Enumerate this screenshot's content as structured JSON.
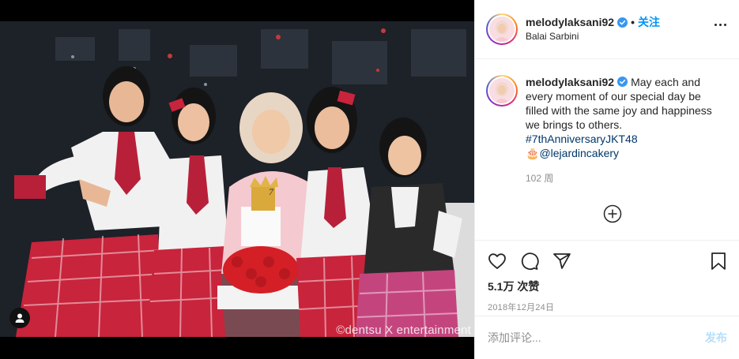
{
  "post": {
    "username": "melodylaksani92",
    "follow_label": "关注",
    "dot": "•",
    "location": "Balai Sarbini",
    "watermark": "©dentsu X entertainment",
    "caption": {
      "text": "May each and every moment of our special day be filled with the same joy and happiness we brings to others.",
      "hashtag": "#7thAnniversaryJKT48",
      "cake_emoji": "🎂",
      "mention": "@lejardincakery",
      "age": "102 周"
    },
    "likes": "5.1万 次赞",
    "date": "2018年12月24日",
    "comment_placeholder": "添加评论...",
    "post_label": "发布"
  },
  "icons": {
    "verified": "verified-badge-icon",
    "more": "more-options-icon",
    "like": "heart-icon",
    "comment": "comment-icon",
    "share": "share-icon",
    "save": "bookmark-icon",
    "load_more": "plus-circle-icon",
    "tag": "user-tag-icon"
  },
  "colors": {
    "accent": "#0095f6",
    "verified": "#3897f0",
    "hashtag": "#00376b",
    "muted": "#8e8e8e",
    "post_disabled": "#b2dffc"
  }
}
